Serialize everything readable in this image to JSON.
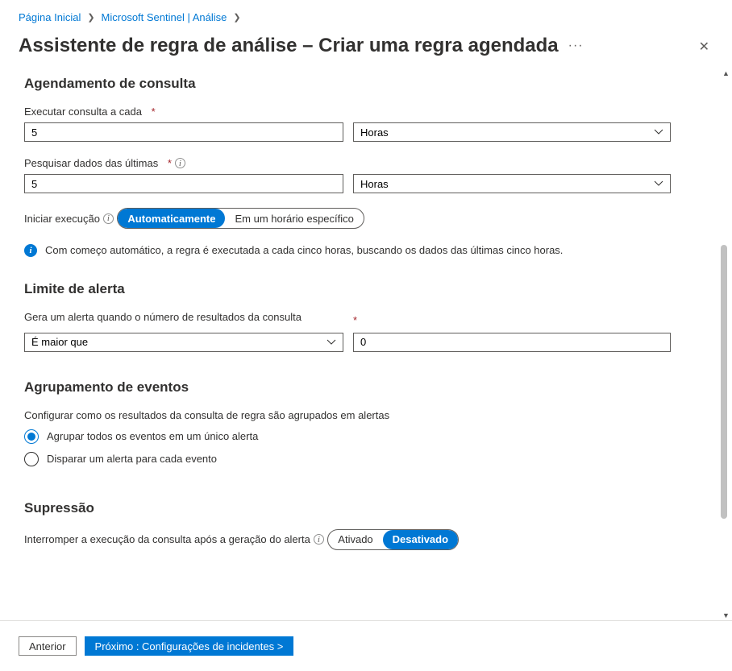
{
  "breadcrumb": {
    "home": "Página Inicial",
    "sentinel": "Microsoft Sentinel | Análise"
  },
  "header": {
    "title": "Assistente de regra de análise – Criar uma regra agendada"
  },
  "schedule": {
    "heading": "Agendamento de consulta",
    "run_every_label": "Executar consulta a cada",
    "run_every_value": "5",
    "run_every_unit": "Horas",
    "lookup_label": "Pesquisar dados das últimas",
    "lookup_value": "5",
    "lookup_unit": "Horas",
    "start_label": "Iniciar execução",
    "start_auto": "Automaticamente",
    "start_specific": "Em um horário específico",
    "info_text": "Com começo automático, a regra é executada a cada cinco horas, buscando os dados das últimas cinco horas."
  },
  "threshold": {
    "heading": "Limite de alerta",
    "gen_label": "Gera um alerta quando o número de resultados da consulta",
    "operator": "É maior que",
    "value": "0"
  },
  "grouping": {
    "heading": "Agrupamento de eventos",
    "config_label": "Configurar como os resultados da consulta de regra são agrupados em alertas",
    "opt_all": "Agrupar todos os eventos em um único alerta",
    "opt_each": "Disparar um alerta para cada evento"
  },
  "suppression": {
    "heading": "Supressão",
    "stop_label": "Interromper a execução da consulta após a geração do alerta",
    "on": "Ativado",
    "off": "Desativado"
  },
  "footer": {
    "prev": "Anterior",
    "next": "Próximo : Configurações de incidentes  >"
  }
}
